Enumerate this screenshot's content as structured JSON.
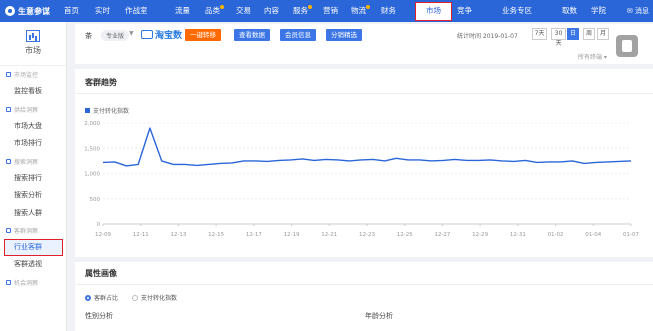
{
  "brand": {
    "title": "生意参谋"
  },
  "nav": {
    "items": [
      {
        "label": "首页",
        "dot": false
      },
      {
        "label": "实时",
        "dot": false
      },
      {
        "label": "作战室",
        "dot": false
      },
      {
        "label": "流量",
        "dot": false
      },
      {
        "label": "品类",
        "dot": true
      },
      {
        "label": "交易",
        "dot": false
      },
      {
        "label": "内容",
        "dot": false
      },
      {
        "label": "服务",
        "dot": true
      },
      {
        "label": "营销",
        "dot": false
      },
      {
        "label": "物流",
        "dot": true
      },
      {
        "label": "财务",
        "dot": false
      },
      {
        "label": "市场",
        "dot": false
      },
      {
        "label": "竞争",
        "dot": false
      },
      {
        "label": "业务专区",
        "dot": false
      },
      {
        "label": "取数",
        "dot": false
      },
      {
        "label": "学院",
        "dot": false
      }
    ],
    "active": "市场",
    "message": "消息"
  },
  "sidebar": {
    "head_label": "市场",
    "sections": [
      {
        "title": "市场监控",
        "items": [
          "监控看板"
        ]
      },
      {
        "title": "供给洞察",
        "items": [
          "市场大盘",
          "市场排行"
        ]
      },
      {
        "title": "搜索洞察",
        "items": [
          "搜索排行",
          "搜索分析",
          "搜索人群"
        ]
      },
      {
        "title": "客群洞察",
        "items": [
          "行业客群",
          "客群透视"
        ]
      },
      {
        "title": "机会洞察",
        "items": []
      }
    ],
    "active_item": "行业客群"
  },
  "toolbar": {
    "shop_name": "茶",
    "shop_tag": "专业版",
    "platform": "淘宝数",
    "buttons": [
      "一键转移",
      "查看数据",
      "会员信息",
      "分销精选"
    ],
    "date_text": "统计时间 2019-01-07",
    "date_buttons": [
      "7天",
      "30天",
      "日",
      "周",
      "月"
    ],
    "active_date": "日",
    "terminal": "所有终端"
  },
  "panel": {
    "title": "客群趋势"
  },
  "chart_data": {
    "type": "line",
    "title": "",
    "xlabel": "",
    "ylabel": "",
    "ylim": [
      0,
      2000
    ],
    "yticks": [
      0,
      500,
      1000,
      1500,
      2000
    ],
    "ytick_labels": [
      "0",
      "500",
      "1,000",
      "1,500",
      "2,000"
    ],
    "xtick_labels": [
      "12-09",
      "12-11",
      "12-13",
      "12-15",
      "12-17",
      "12-19",
      "12-21",
      "12-23",
      "12-25",
      "12-27",
      "12-29",
      "12-31",
      "01-02",
      "01-04",
      "01-07"
    ],
    "grid": true,
    "legend": "top-left",
    "series": [
      {
        "name": "支付转化指数",
        "color": "#2a66d8",
        "values": [
          1220,
          1230,
          1150,
          1180,
          1900,
          1250,
          1180,
          1180,
          1160,
          1180,
          1200,
          1210,
          1250,
          1250,
          1240,
          1260,
          1270,
          1290,
          1260,
          1280,
          1270,
          1250,
          1270,
          1280,
          1250,
          1300,
          1270,
          1270,
          1250,
          1260,
          1280,
          1260,
          1260,
          1270,
          1250,
          1240,
          1260,
          1220,
          1230,
          1230,
          1250,
          1200,
          1220,
          1230,
          1240,
          1250
        ]
      }
    ]
  },
  "panel2": {
    "title": "属性画像",
    "radios": [
      "客群占比",
      "支付转化指数"
    ],
    "active_radio": "客群占比",
    "sub_labels": [
      "性别分析",
      "年龄分析"
    ]
  }
}
